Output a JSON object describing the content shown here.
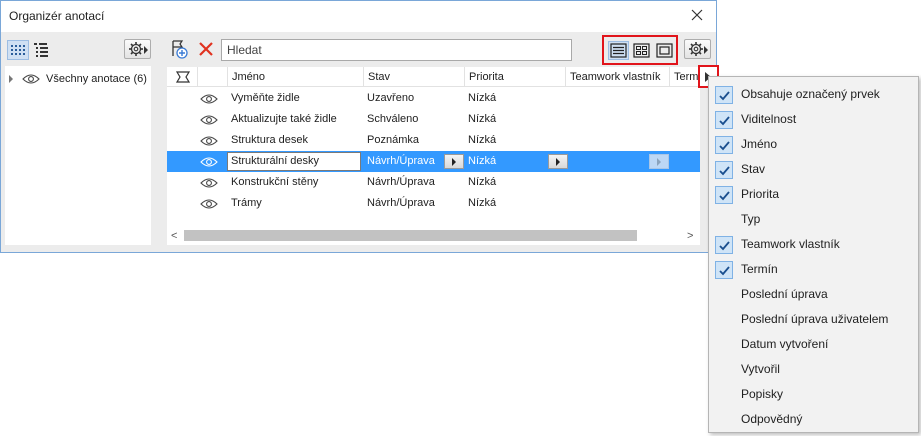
{
  "window": {
    "title": "Organizér anotací"
  },
  "left_panel": {
    "tree_root_label": "Všechny anotace (6)"
  },
  "right_panel": {
    "search": {
      "placeholder": "Hledat",
      "value": ""
    }
  },
  "table": {
    "columns": [
      "",
      "",
      "Jméno",
      "Stav",
      "Priorita",
      "Teamwork vlastník",
      "Termín"
    ],
    "rows": [
      {
        "name": "Vyměňte židle",
        "status": "Uzavřeno",
        "priority": "Nízká",
        "selected": false
      },
      {
        "name": "Aktualizujte také židle",
        "status": "Schváleno",
        "priority": "Nízká",
        "selected": false
      },
      {
        "name": "Struktura desek",
        "status": "Poznámka",
        "priority": "Nízká",
        "selected": false
      },
      {
        "name": "Strukturální desky",
        "status": "Návrh/Úprava",
        "priority": "Nízká",
        "selected": true
      },
      {
        "name": "Konstrukční stěny",
        "status": "Návrh/Úprava",
        "priority": "Nízká",
        "selected": false
      },
      {
        "name": "Trámy",
        "status": "Návrh/Úprava",
        "priority": "Nízká",
        "selected": false
      }
    ]
  },
  "column_menu": {
    "items": [
      {
        "label": "Obsahuje označený prvek",
        "checked": true
      },
      {
        "label": "Viditelnost",
        "checked": true
      },
      {
        "label": "Jméno",
        "checked": true
      },
      {
        "label": "Stav",
        "checked": true
      },
      {
        "label": "Priorita",
        "checked": true
      },
      {
        "label": "Typ",
        "checked": false
      },
      {
        "label": "Teamwork vlastník",
        "checked": true
      },
      {
        "label": "Termín",
        "checked": true
      },
      {
        "label": "Poslední úprava",
        "checked": false
      },
      {
        "label": "Poslední úprava uživatelem",
        "checked": false
      },
      {
        "label": "Datum vytvoření",
        "checked": false
      },
      {
        "label": "Vytvořil",
        "checked": false
      },
      {
        "label": "Popisky",
        "checked": false
      },
      {
        "label": "Odpovědný",
        "checked": false
      }
    ]
  },
  "colors": {
    "selection": "#3399ff",
    "highlight_frame": "#e1141b",
    "delete_icon": "#e0321f",
    "check_bg": "#cfe4f7"
  }
}
